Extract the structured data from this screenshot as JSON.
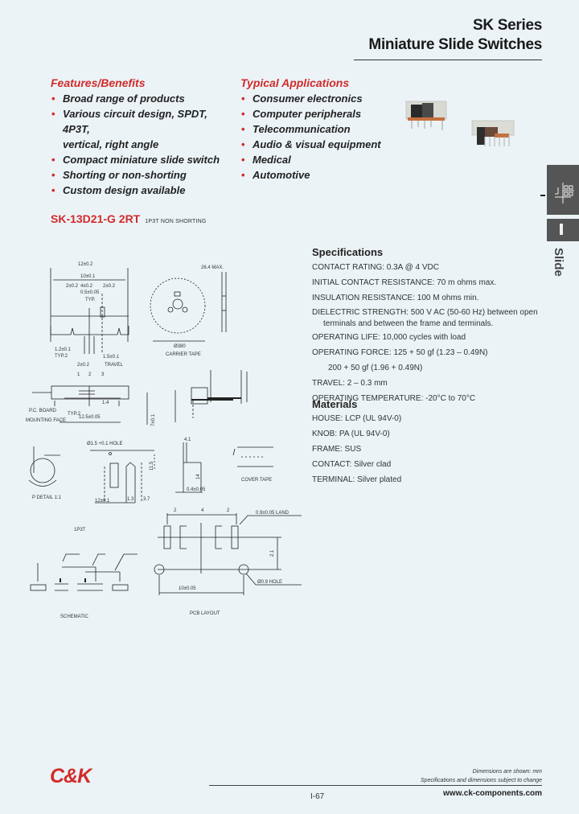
{
  "header": {
    "series": "SK Series",
    "title": "Miniature Slide Switches"
  },
  "features": {
    "heading": "Features/Benefits",
    "items": [
      "Broad range of products",
      "Various circuit design, SPDT, 4P3T,",
      "Compact miniature slide switch",
      "Shorting or non-shorting",
      "Custom design available"
    ],
    "item2_cont": "vertical, right angle"
  },
  "applications": {
    "heading": "Typical Applications",
    "items": [
      "Consumer electronics",
      "Computer peripherals",
      "Telecommunication",
      "Audio & visual equipment",
      "Medical",
      "Automotive"
    ]
  },
  "side_tab": {
    "icon": "slide-switch-schematic-icon",
    "letter": "I",
    "label": "Slide"
  },
  "part": {
    "number": "SK-13D21-G 2RT",
    "description": "1P3T NON SHORTING"
  },
  "specifications": {
    "heading": "Specifications",
    "lines": [
      "CONTACT RATING:  0.3A @ 4 VDC",
      "INITIAL  CONTACT RESISTANCE:  70 m ohms max.",
      "INSULATION RESISTANCE: 100 M ohms min.",
      "DIELECTRIC STRENGTH: 500 V AC (50-60 Hz) between open",
      "terminals and between the frame and terminals.",
      "OPERATING LIFE: 10,000 cycles with load",
      "OPERATING FORCE: 125 + 50 gf  (1.23 – 0.49N)",
      "200 + 50 gf (1.96 + 0.49N)",
      "TRAVEL: 2 – 0.3 mm",
      "OPERATING TEMPERATURE: -20°C to 70°C"
    ]
  },
  "materials": {
    "heading": "Materials",
    "lines": [
      "HOUSE: LCP (UL 94V-0)",
      "KNOB: PA (UL 94V-0)",
      "FRAME: SUS",
      "CONTACT: Silver clad",
      "TERMINAL: Silver plated"
    ]
  },
  "drawing_labels": {
    "dim_top": "12±0.2",
    "dim_inner": "10±0.1",
    "dim_a": "2±0.2",
    "dim_b": "4±0.2",
    "dim_c": "2±0.2",
    "dim_d": "0.5±0.05",
    "typ": "TYP.",
    "max": "26.4 MAX.",
    "reel": "Ø380",
    "carrier": "CARRIER TAPE",
    "dim_left": "1.2±0.1",
    "typ2": "TYP.2",
    "dim_15": "1.5±0.1",
    "dim_202": "2±0.2",
    "travel": "TRAVEL",
    "pin1": "1",
    "pin2": "2",
    "pin3": "3",
    "pc_board": "P.C. BOARD",
    "mounting": "MOUNTING FACE",
    "typ_b": "TYP.2",
    "dim_125": "12.5±0.05",
    "dim_7": "7±0.1",
    "dim_14": "1.4",
    "pdetail": "P DETAIL 1:1",
    "hole": "Ø1.5 +0.1 HOLE",
    "dim_12": "12±0.1",
    "dim_115": "11.5",
    "dim_13": "1.3",
    "dim_37": "3.7",
    "dim_41": "4.1",
    "dim_14b": "14",
    "dim_04": "0.4±0.05",
    "cover_tape": "COVER TAPE",
    "schem_title": "1P3T",
    "schematic": "SCHEMATIC",
    "pcb_layout": "PCB LAYOUT",
    "land": "0.9±0.05 LAND",
    "hole2": "Ø0.9 HOLE",
    "dim_10": "10±0.05",
    "dim_21": "2.1",
    "sp2a": "2",
    "sp4": "4",
    "sp2b": "2"
  },
  "footer": {
    "logo": "C&K",
    "note1": "Dimensions are shown: mm",
    "note2": "Specifications and dimensions subject to change",
    "page": "I-67",
    "url": "www.ck-components.com"
  },
  "colors": {
    "accent": "#d22b2b",
    "background": "#ebf3f6",
    "tab": "#555555"
  }
}
